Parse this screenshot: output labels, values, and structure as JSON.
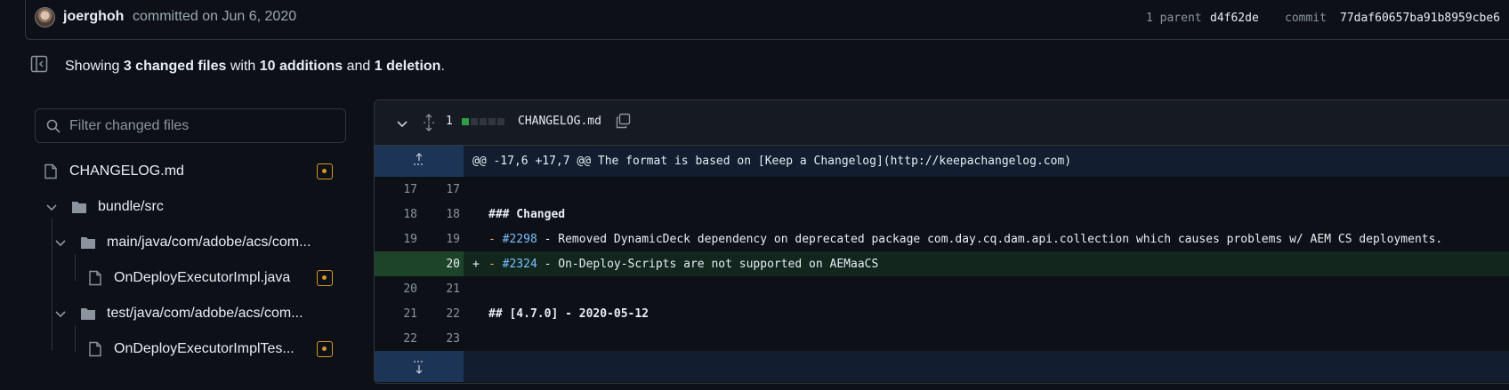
{
  "commit": {
    "author": "joerghoh",
    "committed_text": "committed on Jun 6, 2020",
    "parent_label": "1 parent",
    "parent_sha": "d4f62de",
    "commit_label": "commit",
    "commit_sha": "77daf60657ba91b8959cbe6"
  },
  "summary": {
    "prefix": "Showing",
    "files": "3 changed files",
    "mid1": "with",
    "additions": "10 additions",
    "mid2": "and",
    "deletions": "1 deletion",
    "suffix": "."
  },
  "filter": {
    "placeholder": "Filter changed files"
  },
  "tree": [
    {
      "label": "CHANGELOG.md",
      "type": "file",
      "modified": true
    },
    {
      "label": "bundle/src",
      "type": "folder"
    },
    {
      "label": "main/java/com/adobe/acs/com...",
      "type": "folder"
    },
    {
      "label": "OnDeployExecutorImpl.java",
      "type": "file",
      "modified": true
    },
    {
      "label": "test/java/com/adobe/acs/com...",
      "type": "folder"
    },
    {
      "label": "OnDeployExecutorImplTes...",
      "type": "file",
      "modified": true
    }
  ],
  "diff": {
    "changes_count": "1",
    "file_name": "CHANGELOG.md",
    "diffstat_colors": [
      "#2ea043",
      "#30363d",
      "#30363d",
      "#30363d",
      "#30363d"
    ],
    "hunk_header": "@@ -17,6 +17,7 @@ The format is based on [Keep a Changelog](http://keepachangelog.com)",
    "lines": [
      {
        "old": "17",
        "new": "17",
        "sign": " ",
        "text": ""
      },
      {
        "old": "18",
        "new": "18",
        "sign": " ",
        "text": "### Changed"
      },
      {
        "old": "19",
        "new": "19",
        "sign": " ",
        "bullet": "-",
        "ref": "#2298",
        "text": " - Removed DynamicDeck dependency on deprecated package com.day.cq.dam.api.collection which causes problems w/ AEM CS deployments."
      },
      {
        "old": "",
        "new": "20",
        "sign": "+",
        "bullet": "-",
        "ref": "#2324",
        "text": " - On-Deploy-Scripts are not supported on AEMaaCS"
      },
      {
        "old": "20",
        "new": "21",
        "sign": " ",
        "text": ""
      },
      {
        "old": "21",
        "new": "22",
        "sign": " ",
        "text": "## [4.7.0] - 2020-05-12"
      },
      {
        "old": "22",
        "new": "23",
        "sign": " ",
        "text": ""
      }
    ]
  }
}
